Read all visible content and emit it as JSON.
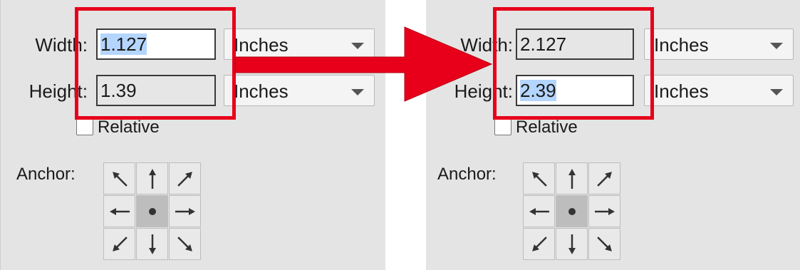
{
  "panels": [
    {
      "id": "before",
      "width_label": "Width:",
      "width_value": "1.127",
      "width_unit": "Inches",
      "height_label": "Height:",
      "height_value": "1.39",
      "height_unit": "Inches",
      "relative_label": "Relative",
      "anchor_label": "Anchor:",
      "selected_field": "width"
    },
    {
      "id": "after",
      "width_label": "Width:",
      "width_value": "2.127",
      "width_unit": "Inches",
      "height_label": "Height:",
      "height_value": "2.39",
      "height_unit": "Inches",
      "relative_label": "Relative",
      "anchor_label": "Anchor:",
      "selected_field": "height"
    }
  ],
  "anchor_cells": [
    "arrow-up-left-icon",
    "arrow-up-icon",
    "arrow-up-right-icon",
    "arrow-left-icon",
    "center-dot-icon",
    "arrow-right-icon",
    "arrow-down-left-icon",
    "arrow-down-icon",
    "arrow-down-right-icon"
  ],
  "colors": {
    "highlight": "#e8001a",
    "selection": "#b4d5fe",
    "panel_bg": "#e4e4e4"
  }
}
